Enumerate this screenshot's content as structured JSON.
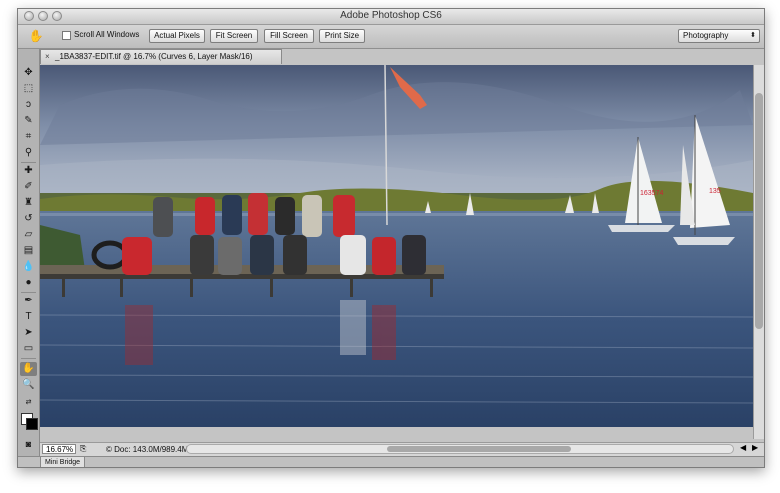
{
  "app": {
    "window_title": "Adobe Photoshop CS6"
  },
  "options_bar": {
    "tool_icon": "hand-tool-icon",
    "scroll_all_windows_label": "Scroll All Windows",
    "scroll_all_windows_checked": false,
    "buttons": [
      "Actual Pixels",
      "Fit Screen",
      "Fill Screen",
      "Print Size"
    ],
    "workspace": "Photography"
  },
  "document": {
    "tab_title": "_1BA3837-EDIT.tif @ 16.7% (Curves 6, Layer Mask/16)",
    "close_label": "×"
  },
  "toolbar": {
    "tools": [
      "move",
      "marquee",
      "lasso",
      "quick-select",
      "crop",
      "eyedropper",
      "healing",
      "brush",
      "clone-stamp",
      "history-brush",
      "eraser",
      "gradient",
      "blur",
      "dodge",
      "pen",
      "type",
      "path-select",
      "rectangle",
      "hand",
      "zoom"
    ],
    "selected_tool": "hand",
    "foreground_color": "#ffffff",
    "background_color": "#000000"
  },
  "status": {
    "zoom": "16.67%",
    "doc_info": "Doc: 143.0M/989.4M"
  },
  "mini_bridge": {
    "label": "Mini Bridge"
  },
  "photo": {
    "sail_numbers": [
      "163574",
      "135"
    ]
  }
}
